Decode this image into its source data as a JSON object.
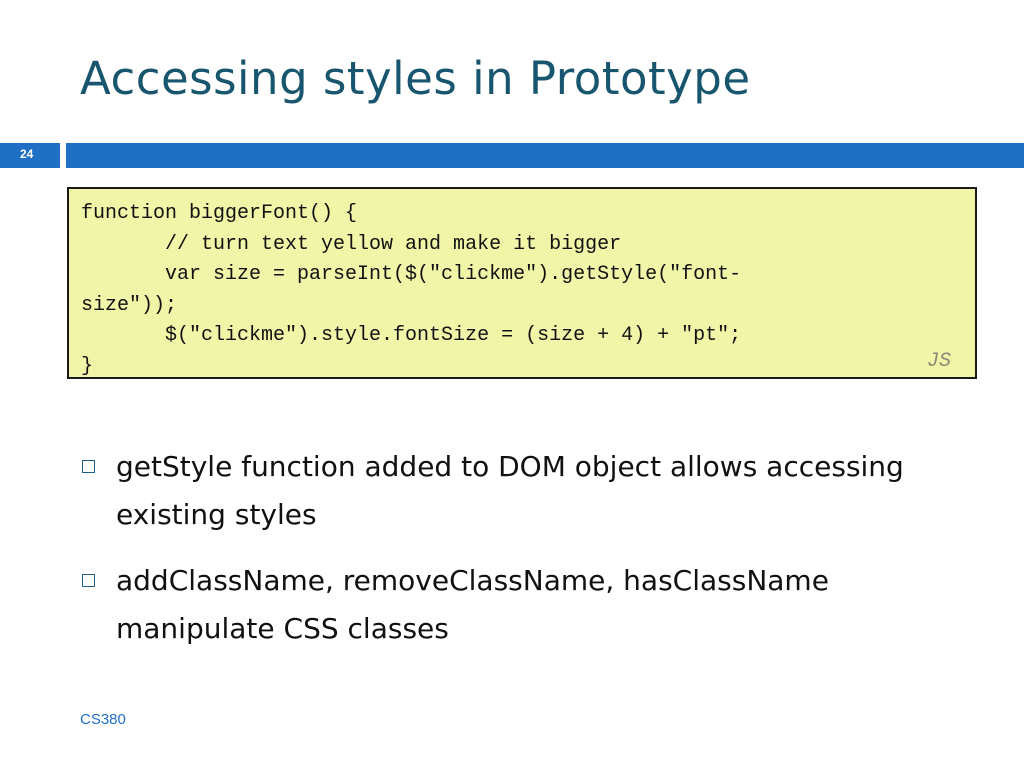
{
  "slide": {
    "title": "Accessing styles in Prototype",
    "number": "24",
    "footer": "CS380"
  },
  "code": {
    "text": "function biggerFont() {\n       // turn text yellow and make it bigger\n       var size = parseInt($(\"clickme\").getStyle(\"font-\nsize\"));\n       $(\"clickme\").style.fontSize = (size + 4) + \"pt\";\n}",
    "language": "JS"
  },
  "bullets": [
    {
      "text": "getStyle function added to DOM object allows accessing existing styles"
    },
    {
      "text": "addClassName, removeClassName, hasClassName manipulate CSS classes"
    }
  ],
  "colors": {
    "title": "#17566e",
    "accent_bar": "#1f6fc5",
    "code_background": "#f0f5a8",
    "footer": "#1f6fc5"
  },
  "icons": {
    "bullet": "hollow-square-bullet-icon"
  }
}
